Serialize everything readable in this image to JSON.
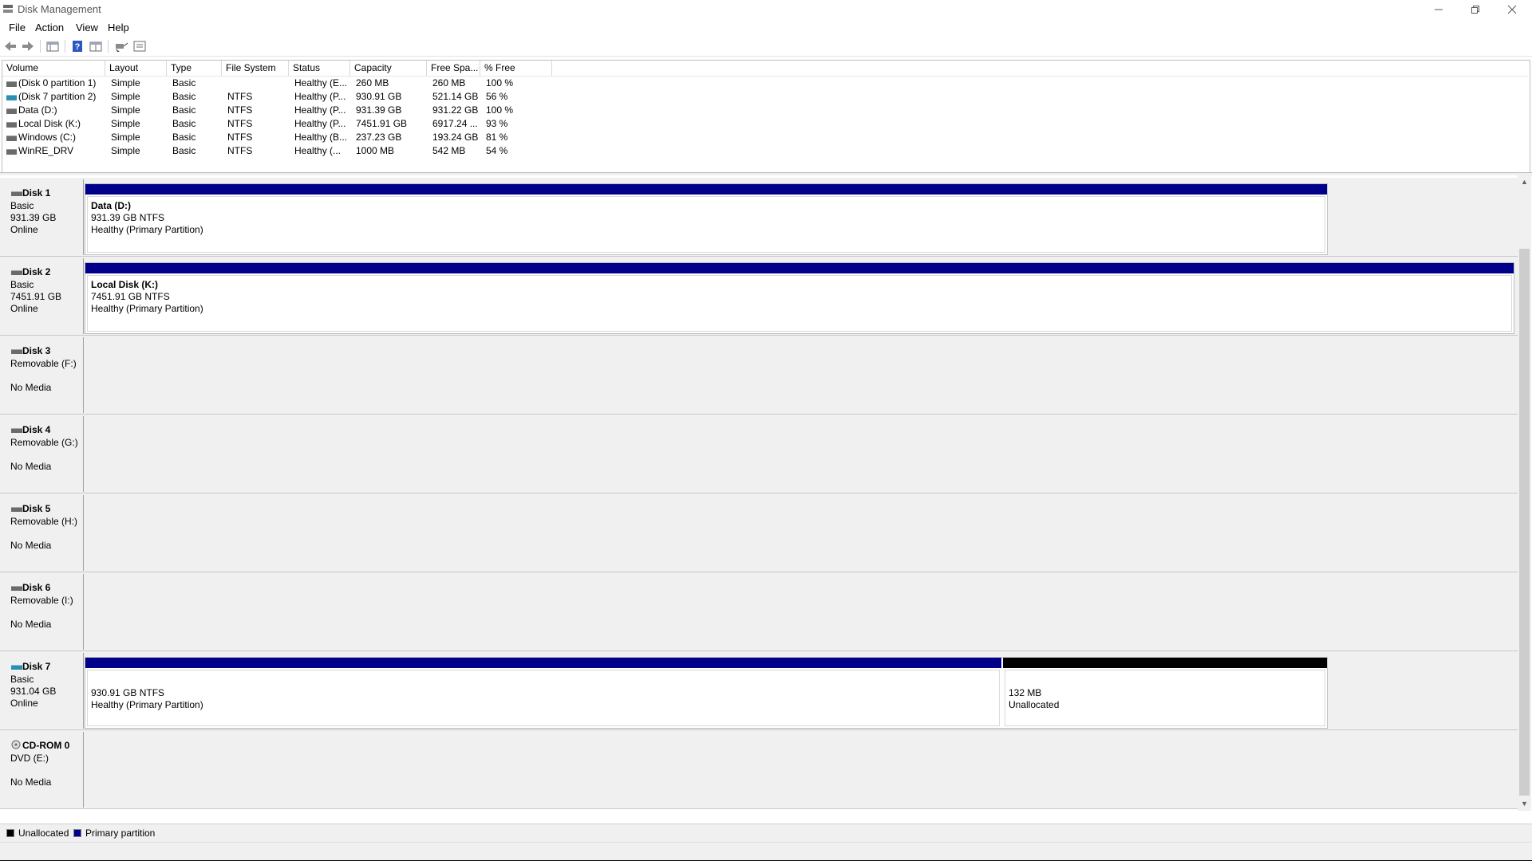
{
  "window": {
    "title": "Disk Management"
  },
  "menu": [
    "File",
    "Action",
    "View",
    "Help"
  ],
  "toolbar": [
    "back-icon",
    "forward-icon",
    "console-tree-icon",
    "help-icon",
    "properties-icon",
    "refresh-icon",
    "view-icon"
  ],
  "volume_list": {
    "columns": [
      "Volume",
      "Layout",
      "Type",
      "File System",
      "Status",
      "Capacity",
      "Free Spa...",
      "% Free"
    ],
    "rows": [
      {
        "volume": "(Disk 0 partition 1)",
        "layout": "Simple",
        "type": "Basic",
        "fs": "",
        "status": "Healthy (E...",
        "capacity": "260 MB",
        "free": "260 MB",
        "pct": "100 %",
        "icon": "disk-icon"
      },
      {
        "volume": "(Disk 7 partition 2)",
        "layout": "Simple",
        "type": "Basic",
        "fs": "NTFS",
        "status": "Healthy (P...",
        "capacity": "930.91 GB",
        "free": "521.14 GB",
        "pct": "56 %",
        "icon": "usb-disk-icon"
      },
      {
        "volume": "Data (D:)",
        "layout": "Simple",
        "type": "Basic",
        "fs": "NTFS",
        "status": "Healthy (P...",
        "capacity": "931.39 GB",
        "free": "931.22 GB",
        "pct": "100 %",
        "icon": "disk-icon"
      },
      {
        "volume": "Local Disk (K:)",
        "layout": "Simple",
        "type": "Basic",
        "fs": "NTFS",
        "status": "Healthy (P...",
        "capacity": "7451.91 GB",
        "free": "6917.24 ...",
        "pct": "93 %",
        "icon": "disk-icon"
      },
      {
        "volume": "Windows (C:)",
        "layout": "Simple",
        "type": "Basic",
        "fs": "NTFS",
        "status": "Healthy (B...",
        "capacity": "237.23 GB",
        "free": "193.24 GB",
        "pct": "81 %",
        "icon": "disk-icon"
      },
      {
        "volume": "WinRE_DRV",
        "layout": "Simple",
        "type": "Basic",
        "fs": "NTFS",
        "status": "Healthy (...",
        "capacity": "1000 MB",
        "free": "542 MB",
        "pct": "54 %",
        "icon": "disk-icon"
      }
    ]
  },
  "disks": [
    {
      "name": "Disk 1",
      "line2": "Basic",
      "line3": "931.39 GB",
      "line4": "Online",
      "partitions": [
        {
          "title": "Data  (D:)",
          "size": "931.39 GB NTFS",
          "status": "Healthy (Primary Partition)",
          "kind": "primary"
        }
      ]
    },
    {
      "name": "Disk 2",
      "line2": "Basic",
      "line3": "7451.91 GB",
      "line4": "Online",
      "partitions": [
        {
          "title": "Local Disk  (K:)",
          "size": "7451.91 GB NTFS",
          "status": "Healthy (Primary Partition)",
          "kind": "primary"
        }
      ]
    },
    {
      "name": "Disk 3",
      "line2": "Removable (F:)",
      "line3": "",
      "line4": "No Media",
      "partitions": []
    },
    {
      "name": "Disk 4",
      "line2": "Removable (G:)",
      "line3": "",
      "line4": "No Media",
      "partitions": []
    },
    {
      "name": "Disk 5",
      "line2": "Removable (H:)",
      "line3": "",
      "line4": "No Media",
      "partitions": []
    },
    {
      "name": "Disk 6",
      "line2": "Removable (I:)",
      "line3": "",
      "line4": "No Media",
      "partitions": []
    },
    {
      "name": "Disk 7",
      "line2": "Basic",
      "line3": "931.04 GB",
      "line4": "Online",
      "partitions": [
        {
          "title": "",
          "size": "930.91 GB NTFS",
          "status": "Healthy (Primary Partition)",
          "kind": "primary"
        },
        {
          "title": "",
          "size": "132 MB",
          "status": "Unallocated",
          "kind": "unallocated"
        }
      ]
    },
    {
      "name": "CD-ROM 0",
      "line2": "DVD (E:)",
      "line3": "",
      "line4": "No Media",
      "partitions": []
    }
  ],
  "legend": [
    {
      "label": "Unallocated",
      "color": "#000000"
    },
    {
      "label": "Primary partition",
      "color": "#00008b"
    }
  ],
  "colors": {
    "primary": "#00008b",
    "unallocated": "#000000"
  }
}
